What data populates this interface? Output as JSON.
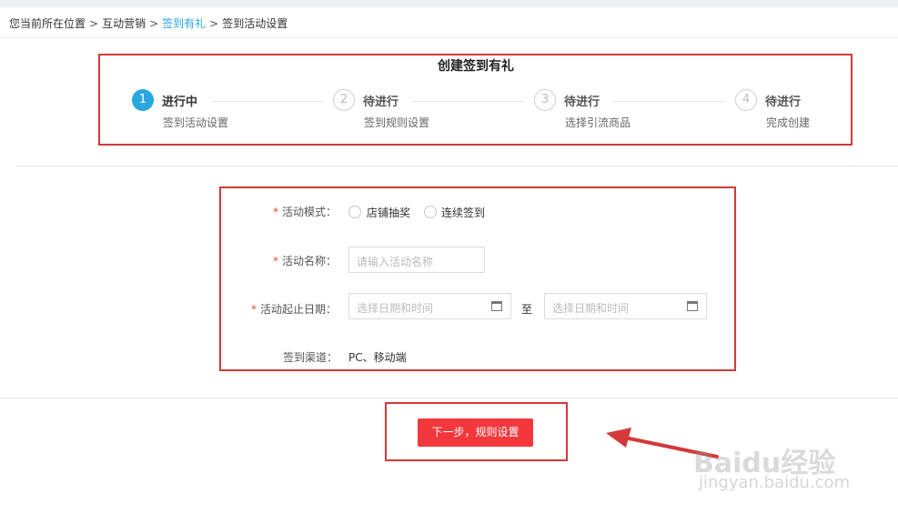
{
  "breadcrumb": {
    "items": [
      "您当前所在位置",
      "互动营销",
      "签到有礼",
      "签到活动设置"
    ],
    "separator": ">"
  },
  "wizard": {
    "title": "创建签到有礼",
    "steps": [
      {
        "number": "1",
        "status": "进行中",
        "name": "签到活动设置"
      },
      {
        "number": "2",
        "status": "待进行",
        "name": "签到规则设置"
      },
      {
        "number": "3",
        "status": "待进行",
        "name": "选择引流商品"
      },
      {
        "number": "4",
        "status": "待进行",
        "name": "完成创建"
      }
    ]
  },
  "form": {
    "required_mark": "*",
    "mode_label": "活动模式：",
    "mode_options": [
      "店铺抽奖",
      "连续签到"
    ],
    "name_label": "活动名称：",
    "name_placeholder": "请输入活动名称",
    "date_label": "活动起止日期：",
    "date_start_placeholder": "选择日期和时间",
    "date_to": "至",
    "date_end_placeholder": "选择日期和时间",
    "channel_label": "签到渠道：",
    "channel_value": "PC、移动端"
  },
  "actions": {
    "next_label": "下一步，规则设置"
  },
  "watermark": {
    "brand": "Baidu经验",
    "url": "jingyan.baidu.com"
  },
  "colors": {
    "accent": "#2aa6e0",
    "primary_button": "#f2383c",
    "highlight_border": "#d3393a"
  }
}
